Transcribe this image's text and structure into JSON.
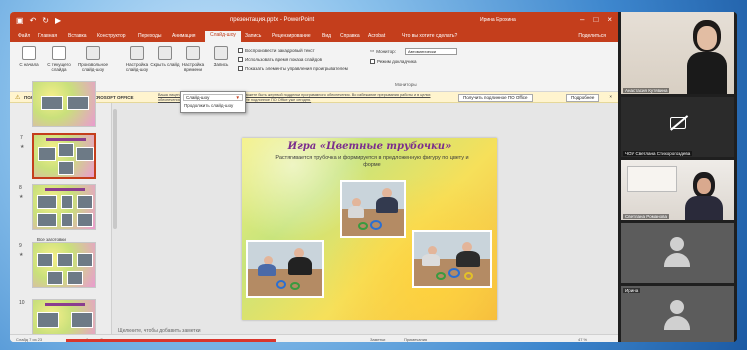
{
  "powerpoint": {
    "document_title": "презентация.pptx - PowerPoint",
    "user_name": "Ирина Ерохина",
    "tabs": [
      "Файл",
      "Главная",
      "Вставка",
      "Конструктор",
      "Переходы",
      "Анимация",
      "Слайд-шоу",
      "Запись",
      "Рецензирование",
      "Вид",
      "Справка",
      "Acrobat",
      "Что вы хотите сделать?"
    ],
    "active_tab": "Слайд-шоу",
    "share_label": "Поделиться",
    "ribbon": {
      "buttons": [
        "С начала",
        "С текущего слайда",
        "Произвольное слайд-шоу",
        "Настройка слайд-шоу",
        "Скрыть слайд",
        "Настройка времени",
        "Запись"
      ],
      "checkboxes": [
        "Воспроизвести закадровый текст",
        "Использовать время показа слайдов",
        "Показать элементы управления проигрывателем"
      ],
      "monitor_label": "Монитор:",
      "monitor_value": "Автоматически",
      "presenter_view_label": "Режим докладчика",
      "groups": [
        "Начать слайд-шоу",
        "Мониторы"
      ]
    },
    "dropdown": {
      "selected": "Слайд-шоу",
      "options": [
        "Продолжить слайд-шоу"
      ]
    },
    "notification": {
      "title": "ПОЛУЧИТЬ ПОДЛИННОЕ ПО MICROSOFT OFFICE",
      "message": "Ваша лицензия на Office недействительна, и вы можете быть жертвой подделки программного обеспечения. Во избежание прерывания работы и в целях обеспечения безопасности ваших файлов получите подлинное ПО Office уже сегодня.",
      "btn_primary": "Получить подлинное ПО Office",
      "btn_secondary": "Подробнее"
    },
    "thumbnails": [
      {
        "num": "",
        "caption": ""
      },
      {
        "num": "7",
        "caption": ""
      },
      {
        "num": "8",
        "caption": ""
      },
      {
        "num": "9",
        "caption": "Все заготовки"
      },
      {
        "num": "10",
        "caption": ""
      }
    ],
    "slide": {
      "title": "Игра «Цветные трубочки»",
      "text": "Растягивается трубочка и формируется в предложенную фигуру по цвету и форме"
    },
    "notes_placeholder": "Щелкните, чтобы добавить заметки",
    "status": {
      "slide": "Слайд 7 из 23",
      "language": "русский",
      "accessibility": "Специальные возможности: проверьте рекомендации",
      "notes": "Заметки",
      "comments": "Примечания",
      "zoom": "47 %"
    },
    "progress_fraction": 0.35
  },
  "participants": [
    {
      "name": "Анастасия Кутявина",
      "camera": "on"
    },
    {
      "name": "ЧОУ Светлана Стихорогоздева",
      "camera": "off"
    },
    {
      "name": "Светлана Романова",
      "camera": "on"
    },
    {
      "name": "",
      "camera": "avatar"
    },
    {
      "name": "Ирина",
      "camera": "avatar"
    }
  ],
  "colors": {
    "accent": "#c43e1c",
    "notification_bg": "#fff4ce",
    "slide_title": "#7b2d8d"
  }
}
